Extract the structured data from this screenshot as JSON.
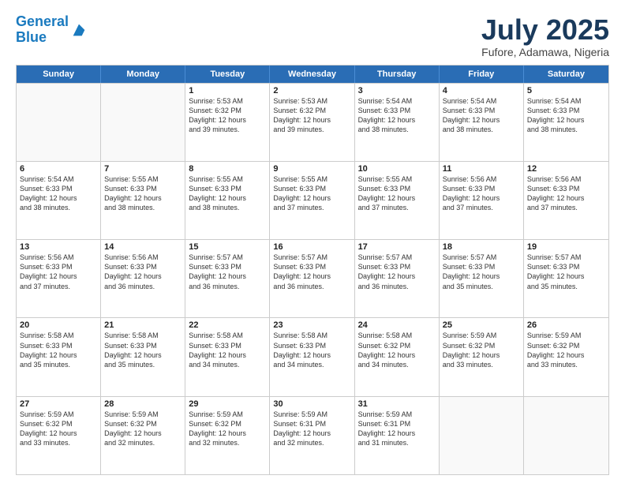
{
  "header": {
    "logo_line1": "General",
    "logo_line2": "Blue",
    "month": "July 2025",
    "location": "Fufore, Adamawa, Nigeria"
  },
  "weekdays": [
    "Sunday",
    "Monday",
    "Tuesday",
    "Wednesday",
    "Thursday",
    "Friday",
    "Saturday"
  ],
  "rows": [
    [
      {
        "day": "",
        "lines": []
      },
      {
        "day": "",
        "lines": []
      },
      {
        "day": "1",
        "lines": [
          "Sunrise: 5:53 AM",
          "Sunset: 6:32 PM",
          "Daylight: 12 hours",
          "and 39 minutes."
        ]
      },
      {
        "day": "2",
        "lines": [
          "Sunrise: 5:53 AM",
          "Sunset: 6:32 PM",
          "Daylight: 12 hours",
          "and 39 minutes."
        ]
      },
      {
        "day": "3",
        "lines": [
          "Sunrise: 5:54 AM",
          "Sunset: 6:33 PM",
          "Daylight: 12 hours",
          "and 38 minutes."
        ]
      },
      {
        "day": "4",
        "lines": [
          "Sunrise: 5:54 AM",
          "Sunset: 6:33 PM",
          "Daylight: 12 hours",
          "and 38 minutes."
        ]
      },
      {
        "day": "5",
        "lines": [
          "Sunrise: 5:54 AM",
          "Sunset: 6:33 PM",
          "Daylight: 12 hours",
          "and 38 minutes."
        ]
      }
    ],
    [
      {
        "day": "6",
        "lines": [
          "Sunrise: 5:54 AM",
          "Sunset: 6:33 PM",
          "Daylight: 12 hours",
          "and 38 minutes."
        ]
      },
      {
        "day": "7",
        "lines": [
          "Sunrise: 5:55 AM",
          "Sunset: 6:33 PM",
          "Daylight: 12 hours",
          "and 38 minutes."
        ]
      },
      {
        "day": "8",
        "lines": [
          "Sunrise: 5:55 AM",
          "Sunset: 6:33 PM",
          "Daylight: 12 hours",
          "and 38 minutes."
        ]
      },
      {
        "day": "9",
        "lines": [
          "Sunrise: 5:55 AM",
          "Sunset: 6:33 PM",
          "Daylight: 12 hours",
          "and 37 minutes."
        ]
      },
      {
        "day": "10",
        "lines": [
          "Sunrise: 5:55 AM",
          "Sunset: 6:33 PM",
          "Daylight: 12 hours",
          "and 37 minutes."
        ]
      },
      {
        "day": "11",
        "lines": [
          "Sunrise: 5:56 AM",
          "Sunset: 6:33 PM",
          "Daylight: 12 hours",
          "and 37 minutes."
        ]
      },
      {
        "day": "12",
        "lines": [
          "Sunrise: 5:56 AM",
          "Sunset: 6:33 PM",
          "Daylight: 12 hours",
          "and 37 minutes."
        ]
      }
    ],
    [
      {
        "day": "13",
        "lines": [
          "Sunrise: 5:56 AM",
          "Sunset: 6:33 PM",
          "Daylight: 12 hours",
          "and 37 minutes."
        ]
      },
      {
        "day": "14",
        "lines": [
          "Sunrise: 5:56 AM",
          "Sunset: 6:33 PM",
          "Daylight: 12 hours",
          "and 36 minutes."
        ]
      },
      {
        "day": "15",
        "lines": [
          "Sunrise: 5:57 AM",
          "Sunset: 6:33 PM",
          "Daylight: 12 hours",
          "and 36 minutes."
        ]
      },
      {
        "day": "16",
        "lines": [
          "Sunrise: 5:57 AM",
          "Sunset: 6:33 PM",
          "Daylight: 12 hours",
          "and 36 minutes."
        ]
      },
      {
        "day": "17",
        "lines": [
          "Sunrise: 5:57 AM",
          "Sunset: 6:33 PM",
          "Daylight: 12 hours",
          "and 36 minutes."
        ]
      },
      {
        "day": "18",
        "lines": [
          "Sunrise: 5:57 AM",
          "Sunset: 6:33 PM",
          "Daylight: 12 hours",
          "and 35 minutes."
        ]
      },
      {
        "day": "19",
        "lines": [
          "Sunrise: 5:57 AM",
          "Sunset: 6:33 PM",
          "Daylight: 12 hours",
          "and 35 minutes."
        ]
      }
    ],
    [
      {
        "day": "20",
        "lines": [
          "Sunrise: 5:58 AM",
          "Sunset: 6:33 PM",
          "Daylight: 12 hours",
          "and 35 minutes."
        ]
      },
      {
        "day": "21",
        "lines": [
          "Sunrise: 5:58 AM",
          "Sunset: 6:33 PM",
          "Daylight: 12 hours",
          "and 35 minutes."
        ]
      },
      {
        "day": "22",
        "lines": [
          "Sunrise: 5:58 AM",
          "Sunset: 6:33 PM",
          "Daylight: 12 hours",
          "and 34 minutes."
        ]
      },
      {
        "day": "23",
        "lines": [
          "Sunrise: 5:58 AM",
          "Sunset: 6:33 PM",
          "Daylight: 12 hours",
          "and 34 minutes."
        ]
      },
      {
        "day": "24",
        "lines": [
          "Sunrise: 5:58 AM",
          "Sunset: 6:32 PM",
          "Daylight: 12 hours",
          "and 34 minutes."
        ]
      },
      {
        "day": "25",
        "lines": [
          "Sunrise: 5:59 AM",
          "Sunset: 6:32 PM",
          "Daylight: 12 hours",
          "and 33 minutes."
        ]
      },
      {
        "day": "26",
        "lines": [
          "Sunrise: 5:59 AM",
          "Sunset: 6:32 PM",
          "Daylight: 12 hours",
          "and 33 minutes."
        ]
      }
    ],
    [
      {
        "day": "27",
        "lines": [
          "Sunrise: 5:59 AM",
          "Sunset: 6:32 PM",
          "Daylight: 12 hours",
          "and 33 minutes."
        ]
      },
      {
        "day": "28",
        "lines": [
          "Sunrise: 5:59 AM",
          "Sunset: 6:32 PM",
          "Daylight: 12 hours",
          "and 32 minutes."
        ]
      },
      {
        "day": "29",
        "lines": [
          "Sunrise: 5:59 AM",
          "Sunset: 6:32 PM",
          "Daylight: 12 hours",
          "and 32 minutes."
        ]
      },
      {
        "day": "30",
        "lines": [
          "Sunrise: 5:59 AM",
          "Sunset: 6:31 PM",
          "Daylight: 12 hours",
          "and 32 minutes."
        ]
      },
      {
        "day": "31",
        "lines": [
          "Sunrise: 5:59 AM",
          "Sunset: 6:31 PM",
          "Daylight: 12 hours",
          "and 31 minutes."
        ]
      },
      {
        "day": "",
        "lines": []
      },
      {
        "day": "",
        "lines": []
      }
    ]
  ]
}
